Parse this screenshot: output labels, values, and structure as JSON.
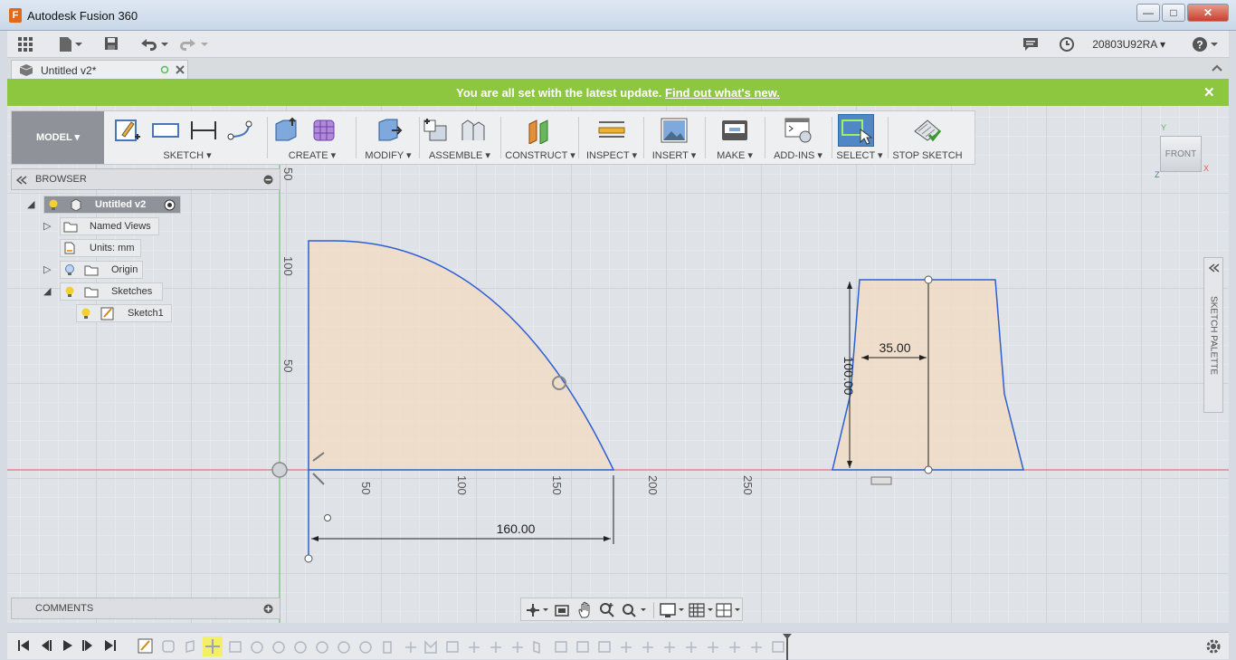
{
  "window": {
    "title": "Autodesk Fusion 360",
    "app_logo": "F",
    "controls": {
      "minimize": "—",
      "maximize": "□",
      "close": "✕"
    }
  },
  "appbar": {
    "user": "20803U92RA",
    "icons": [
      "grid-icon",
      "file-icon",
      "save-icon",
      "undo-icon",
      "redo-icon",
      "comment-icon",
      "clock-icon",
      "help-icon"
    ]
  },
  "tab": {
    "label": "Untitled v2*"
  },
  "banner": {
    "text": "You are all set with the latest update.",
    "link": "Find out what's new.",
    "close": "✕"
  },
  "toolbar": {
    "workspace": "MODEL ▾",
    "groups": {
      "sketch": "SKETCH ▾",
      "create": "CREATE ▾",
      "modify": "MODIFY ▾",
      "assemble": "ASSEMBLE ▾",
      "construct": "CONSTRUCT ▾",
      "inspect": "INSPECT ▾",
      "insert": "INSERT ▾",
      "make": "MAKE ▾",
      "addins": "ADD-INS ▾",
      "select": "SELECT ▾",
      "stop_sketch": "STOP SKETCH"
    }
  },
  "viewcube": {
    "face": "FRONT",
    "x": "X",
    "y": "Y",
    "z": "Z"
  },
  "browser": {
    "title": "BROWSER",
    "root": "Untitled v2",
    "items": {
      "named_views": "Named Views",
      "units": "Units: mm",
      "origin": "Origin",
      "sketches": "Sketches",
      "sketch1": "Sketch1"
    }
  },
  "comments": {
    "title": "COMMENTS"
  },
  "palette": {
    "title": "SKETCH PALETTE"
  },
  "sketch": {
    "axis_labels_x": [
      "50",
      "100",
      "150",
      "200",
      "250"
    ],
    "axis_labels_y": [
      "50",
      "100",
      "50"
    ],
    "dim_width": "160.00",
    "dim_height": "100.00",
    "dim_top": "35.00"
  },
  "colors": {
    "banner": "#8dc63f",
    "sketch_line": "#2c5fd6",
    "sketch_fill": "#f1dcc3",
    "x_axis": "#e05a5a",
    "y_axis": "#59b85c"
  }
}
